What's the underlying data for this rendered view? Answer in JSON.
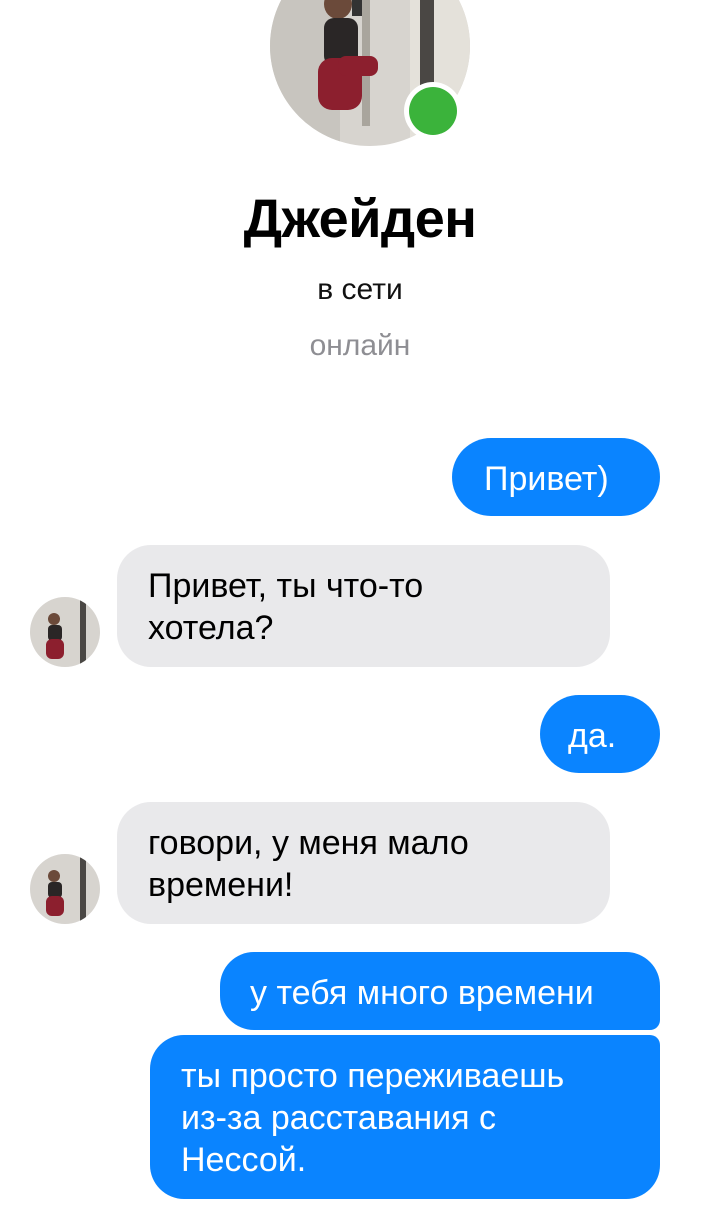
{
  "contact": {
    "name": "Джейден",
    "status": "в сети",
    "sub_status": "онлайн"
  },
  "messages": [
    {
      "direction": "outgoing",
      "text": "Привет)"
    },
    {
      "direction": "incoming",
      "text": "Привет, ты что-то\nхотела?"
    },
    {
      "direction": "outgoing",
      "text": "да."
    },
    {
      "direction": "incoming",
      "text": "говори, у меня мало\nвремени!"
    },
    {
      "direction": "outgoing",
      "text": "у тебя много времени"
    },
    {
      "direction": "outgoing",
      "text": "ты просто переживаешь\nиз-за расставания с\nНессой."
    }
  ],
  "colors": {
    "outgoing_bubble": "#0a84ff",
    "incoming_bubble": "#e9e9eb",
    "online_indicator": "#3bb33b"
  }
}
